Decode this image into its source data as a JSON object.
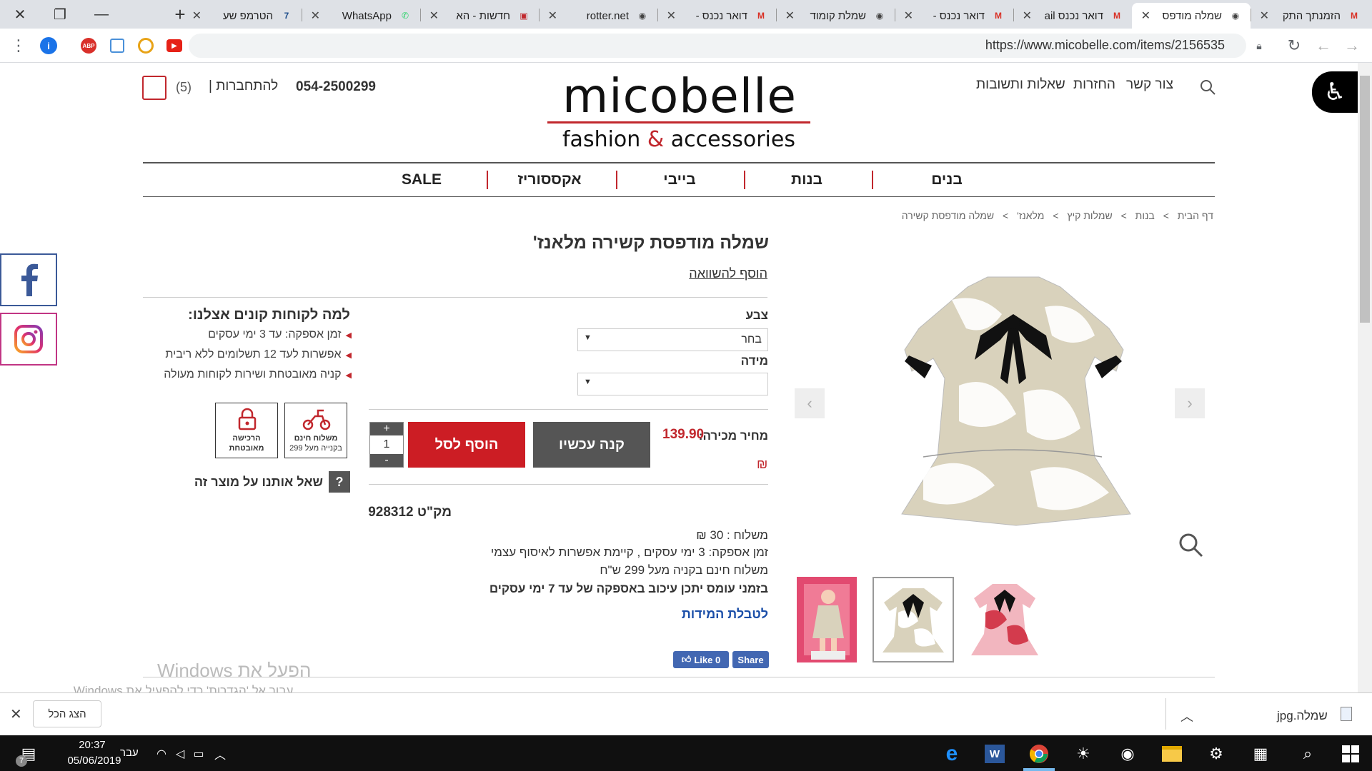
{
  "browser": {
    "tabs": [
      {
        "title": "הזמנתך התק",
        "icon": "M",
        "icon_color": "#d93025"
      },
      {
        "title": "שמלה מודפס",
        "icon": "◉",
        "icon_color": "#444",
        "active": true
      },
      {
        "title": "דואר נכנס ail",
        "icon": "M",
        "icon_color": "#d93025"
      },
      {
        "title": "דואר נכנס -",
        "icon": "M",
        "icon_color": "#d93025"
      },
      {
        "title": "שמלת קומוד",
        "icon": "◉",
        "icon_color": "#444"
      },
      {
        "title": "דואר נכנס -",
        "icon": "M",
        "icon_color": "#d93025"
      },
      {
        "title": "rotter.net",
        "icon": "◉",
        "icon_color": "#444"
      },
      {
        "title": "חדשות - הא",
        "icon": "▣",
        "icon_color": "#c1272d"
      },
      {
        "title": "WhatsApp",
        "icon": "✆",
        "icon_color": "#25d366"
      },
      {
        "title": "הטרמפ שע",
        "icon": "7",
        "icon_color": "#1f4e8c"
      }
    ],
    "new_tab": "+",
    "window_controls": {
      "minimize": "—",
      "restore": "❐",
      "close": "✕"
    },
    "url": "https://www.micobelle.com/items/2156535"
  },
  "site": {
    "logo_main": "micobelle",
    "logo_sub_a": "fashion ",
    "logo_amp": "&",
    "logo_sub_b": " accessories",
    "top_links": [
      "צור קשר",
      "החזרות",
      "שאלות ותשובות"
    ],
    "phone": "054-2500299",
    "login": "להתחברות |",
    "cart_count": "(5)",
    "nav": [
      "בנים",
      "בנות",
      "בייבי",
      "אקססוריז",
      "SALE"
    ],
    "accent": "#c1272d"
  },
  "breadcrumb": [
    "דף הבית",
    ">",
    "בנות",
    ">",
    "שמלות קיץ",
    ">",
    "מלאנז'",
    ">",
    "שמלה מודפסת קשירה"
  ],
  "product": {
    "title": "שמלה מודפסת קשירה מלאנז'",
    "compare": "הוסף להשוואה",
    "color_label": "צבע",
    "color_value": "בחר",
    "size_label": "מידה",
    "size_value": "",
    "price_label": "מחיר מכירה:",
    "price": "139.90",
    "currency": "₪",
    "buy_now": "קנה עכשיו",
    "add_to_cart": "הוסף לסל",
    "qty": "1",
    "qty_plus": "+",
    "qty_minus": "-",
    "sku": "מק\"ט 928312",
    "shipping_lines": [
      "משלוח : 30 ₪",
      "זמן אספקה: 3 ימי עסקים , קיימת אפשרות לאיסוף עצמי",
      "משלוח חינם בקניה מעל 299 ש\"ח",
      "בזמני עומס יתכן עיכוב באספקה של עד 7 ימי עסקים"
    ],
    "size_chart": "לטבלת המידות",
    "fb_like": "Like 0",
    "fb_share": "Share"
  },
  "why": {
    "title": "למה לקוחות קונים אצלנו:",
    "items": [
      "זמן אספקה: עד 3 ימי עסקים",
      "אפשרות לעד 12 תשלומים ללא ריבית",
      "קניה מאובטחת ושירות לקוחות מעולה"
    ],
    "badge_ship_a": "משלוח חינם",
    "badge_ship_b": "בקנייה מעל 299",
    "badge_secure_a": "הרכישה",
    "badge_secure_b": "מאובטחת",
    "ask": "שאל אותנו על מוצר זה",
    "ask_icon": "?"
  },
  "watermark": {
    "line1": "הפעל את Windows",
    "line2": "עבור אל 'הגדרות' כדי להפעיל את Windows."
  },
  "download_bar": {
    "show_all": "הצג הכל",
    "file": "שמלה.jpg"
  },
  "taskbar": {
    "time": "20:37",
    "date": "05/06/2019",
    "lang": "עבר",
    "badge": "7"
  }
}
